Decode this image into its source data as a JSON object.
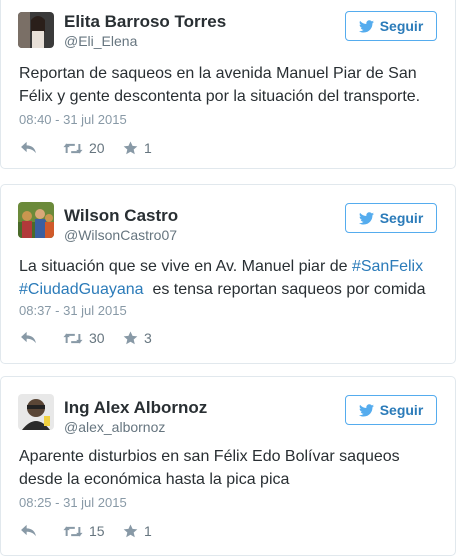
{
  "follow_label": "Seguir",
  "icons": {
    "reply": "reply-icon",
    "retweet": "retweet-icon",
    "favorite": "star-icon",
    "twitter": "twitter-bird-icon"
  },
  "colors": {
    "link": "#2b7bb9",
    "button_border": "#55acee",
    "muted": "#8899a6"
  },
  "tweets": [
    {
      "name": "Elita Barroso Torres",
      "handle": "@Eli_Elena",
      "text_line1": "Reportan de saqueos en la avenida Manuel Piar de San",
      "text_line2": "Félix y gente descontenta por la situación del transporte.",
      "time": "08:40 - 31 jul 2015",
      "retweets": "20",
      "favorites": "1"
    },
    {
      "name": "Wilson Castro",
      "handle": "@WilsonCastro07",
      "text_line1_a": "La situación que se vive en Av. Manuel piar de ",
      "hashtag1": "#SanFelix",
      "hashtag2": "#CiudadGuayana",
      "text_line2_b": "  es tensa reportan saqueos por comida",
      "time": "08:37 - 31 jul 2015",
      "retweets": "30",
      "favorites": "3"
    },
    {
      "name": "Ing Alex Albornoz",
      "handle": "@alex_albornoz",
      "text_line1": "Aparente disturbios en san Félix Edo Bolívar saqueos",
      "text_line2": "desde la económica hasta la pica pica",
      "time": "08:25 - 31 jul 2015",
      "retweets": "15",
      "favorites": "1"
    }
  ]
}
